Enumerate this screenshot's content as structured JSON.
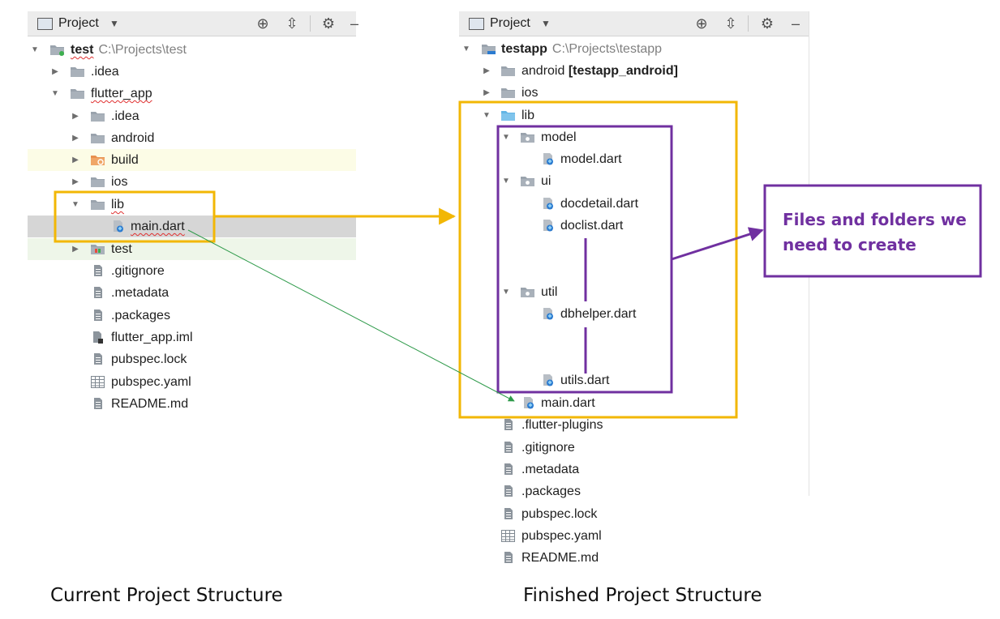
{
  "left_panel": {
    "toolbar_title": "Project",
    "tree": [
      {
        "label": "test",
        "path": "C:\\Projects\\test",
        "icon": "module-folder-icon"
      },
      {
        "label": ".idea",
        "icon": "folder-icon"
      },
      {
        "label": "flutter_app",
        "icon": "folder-icon"
      },
      {
        "label": ".idea",
        "icon": "folder-icon"
      },
      {
        "label": "android",
        "icon": "folder-icon"
      },
      {
        "label": "build",
        "icon": "excluded-folder-icon"
      },
      {
        "label": "ios",
        "icon": "folder-icon"
      },
      {
        "label": "lib",
        "icon": "folder-icon"
      },
      {
        "label": "main.dart",
        "icon": "dart-file-icon"
      },
      {
        "label": "test",
        "icon": "test-folder-icon"
      },
      {
        "label": ".gitignore",
        "icon": "file-icon"
      },
      {
        "label": ".metadata",
        "icon": "file-icon"
      },
      {
        "label": ".packages",
        "icon": "file-icon"
      },
      {
        "label": "flutter_app.iml",
        "icon": "iml-file-icon"
      },
      {
        "label": "pubspec.lock",
        "icon": "file-icon"
      },
      {
        "label": "pubspec.yaml",
        "icon": "yaml-file-icon"
      },
      {
        "label": "README.md",
        "icon": "file-icon"
      }
    ]
  },
  "right_panel": {
    "toolbar_title": "Project",
    "tree": [
      {
        "label": "testapp",
        "path": "C:\\Projects\\testapp",
        "icon": "module-folder-icon"
      },
      {
        "label": "android",
        "suffix": "[testapp_android]",
        "icon": "folder-icon"
      },
      {
        "label": "ios",
        "icon": "folder-icon"
      },
      {
        "label": "lib",
        "icon": "source-folder-icon"
      },
      {
        "label": "model",
        "icon": "package-icon"
      },
      {
        "label": "model.dart",
        "icon": "dart-file-icon"
      },
      {
        "label": "ui",
        "icon": "package-icon"
      },
      {
        "label": "docdetail.dart",
        "icon": "dart-file-icon"
      },
      {
        "label": "doclist.dart",
        "icon": "dart-file-icon"
      },
      {
        "label": "util",
        "icon": "package-icon"
      },
      {
        "label": "dbhelper.dart",
        "icon": "dart-file-icon"
      },
      {
        "label": "utils.dart",
        "icon": "dart-file-icon"
      },
      {
        "label": "main.dart",
        "icon": "dart-file-icon"
      },
      {
        "label": ".flutter-plugins",
        "icon": "file-icon"
      },
      {
        "label": ".gitignore",
        "icon": "file-icon"
      },
      {
        "label": ".metadata",
        "icon": "file-icon"
      },
      {
        "label": ".packages",
        "icon": "file-icon"
      },
      {
        "label": "pubspec.lock",
        "icon": "file-icon"
      },
      {
        "label": "pubspec.yaml",
        "icon": "yaml-file-icon"
      },
      {
        "label": "README.md",
        "icon": "file-icon"
      }
    ]
  },
  "callout": {
    "text": "Files and folders we need to create"
  },
  "captions": {
    "left": "Current Project Structure",
    "right": "Finished Project Structure"
  },
  "colors": {
    "highlight_box": "#f2b705",
    "callout": "#7030a0",
    "connector_green": "#2e9a4a",
    "folder": "#9aa3ad",
    "dart_blue": "#2b7bd0"
  }
}
